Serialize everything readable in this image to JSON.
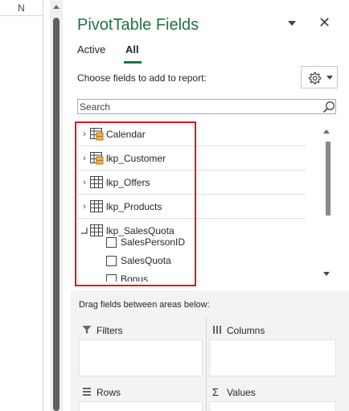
{
  "sheet": {
    "column_letter": "N"
  },
  "panel": {
    "title": "PivotTable Fields",
    "close_glyph": "✕",
    "tabs": [
      {
        "label": "Active",
        "active": false
      },
      {
        "label": "All",
        "active": true
      }
    ],
    "choose_label": "Choose fields to add to report:",
    "settings_icon": "gear-icon",
    "search": {
      "placeholder": "Search",
      "value": ""
    },
    "tables": [
      {
        "name": "Calendar",
        "expanded": false,
        "icon": "table-with-pivot-icon"
      },
      {
        "name": "lkp_Customer",
        "expanded": false,
        "icon": "table-with-pivot-icon"
      },
      {
        "name": "lkp_Offers",
        "expanded": false,
        "icon": "table-icon"
      },
      {
        "name": "lkp_Products",
        "expanded": false,
        "icon": "table-icon"
      },
      {
        "name": "lkp_SalesQuota",
        "expanded": true,
        "icon": "table-icon",
        "fields": [
          {
            "name": "SalesPersonID",
            "checked": false
          },
          {
            "name": "SalesQuota",
            "checked": false
          },
          {
            "name": "Bonus",
            "checked": false
          }
        ]
      }
    ],
    "expander_collapsed": "›",
    "expander_expanded": "⌐",
    "highlight_color": "#e0161f",
    "accent_color": "#217346"
  },
  "areas": {
    "drag_label": "Drag fields between areas below:",
    "filters": {
      "label": "Filters",
      "icon": "filter-icon"
    },
    "columns": {
      "label": "Columns",
      "icon": "columns-icon"
    },
    "rows": {
      "label": "Rows",
      "icon": "rows-icon"
    },
    "values": {
      "label": "Values",
      "icon": "sigma-icon"
    }
  }
}
